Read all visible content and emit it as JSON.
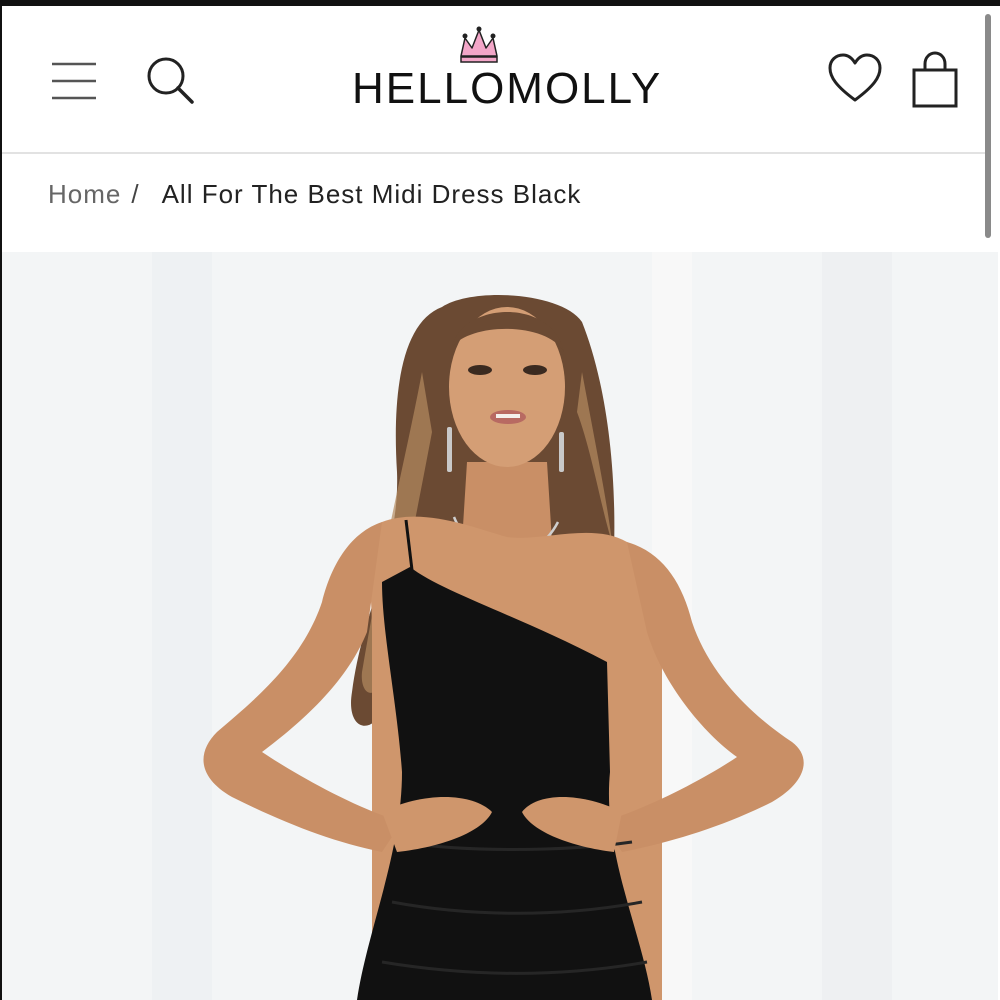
{
  "header": {
    "brand": "HELLOMOLLY",
    "icons": [
      "menu-icon",
      "search-icon",
      "heart-icon",
      "shopping-bag-icon"
    ],
    "crown_color": "#f3a6c8"
  },
  "breadcrumb": {
    "home": "Home",
    "separator": "/",
    "current": "All For The Best Midi Dress Black"
  },
  "product": {
    "image_alt": "Model wearing a black one-shoulder midi dress"
  }
}
